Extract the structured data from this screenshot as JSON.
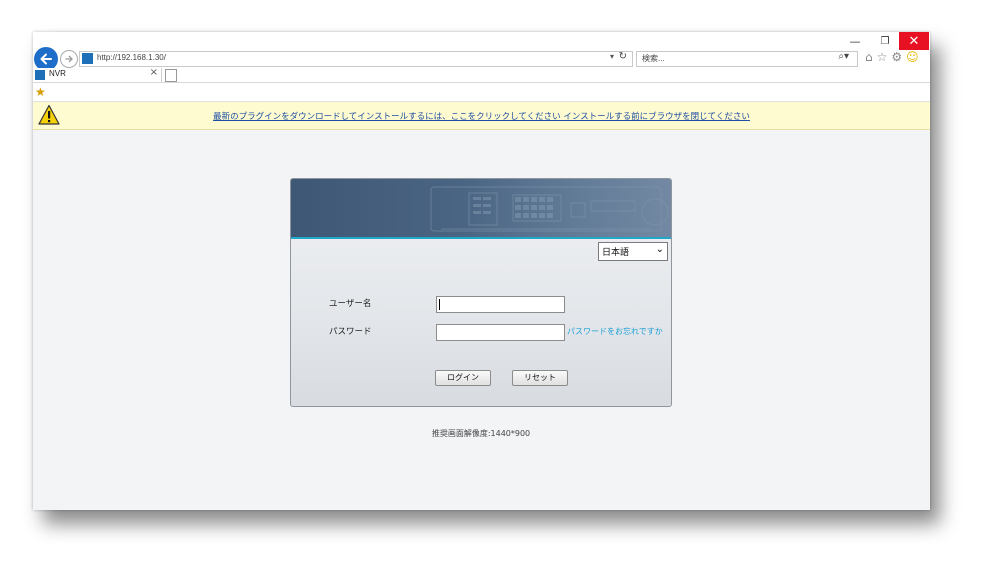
{
  "browser": {
    "url": "http://192.168.1.30/",
    "search_placeholder": "検索...",
    "tab_title": "NVR",
    "window_controls": {
      "minimize": "—",
      "restore": "❐",
      "close": "✕"
    },
    "icons": [
      "home-icon",
      "star-icon",
      "gear-icon",
      "smiley-icon"
    ]
  },
  "infobar": {
    "message": "最新のプラグインをダウンロードしてインストールするには、ここをクリックしてください インストールする前にブラウザを閉じてください"
  },
  "login": {
    "language": "日本語",
    "username_label": "ユーザー名",
    "password_label": "パスワード",
    "username_value": "",
    "password_value": "",
    "forgot_password": "パスワードをお忘れですか",
    "login_button": "ログイン",
    "reset_button": "リセット"
  },
  "footer": {
    "recommended_resolution": "推奨画面解像度:1440*900"
  },
  "colors": {
    "accent_blue": "#1c6ec9",
    "close_red": "#e81123",
    "link_cyan": "#1a9fd6",
    "banner_dark": "#3e5775",
    "infobar_bg": "#fffbd0"
  }
}
